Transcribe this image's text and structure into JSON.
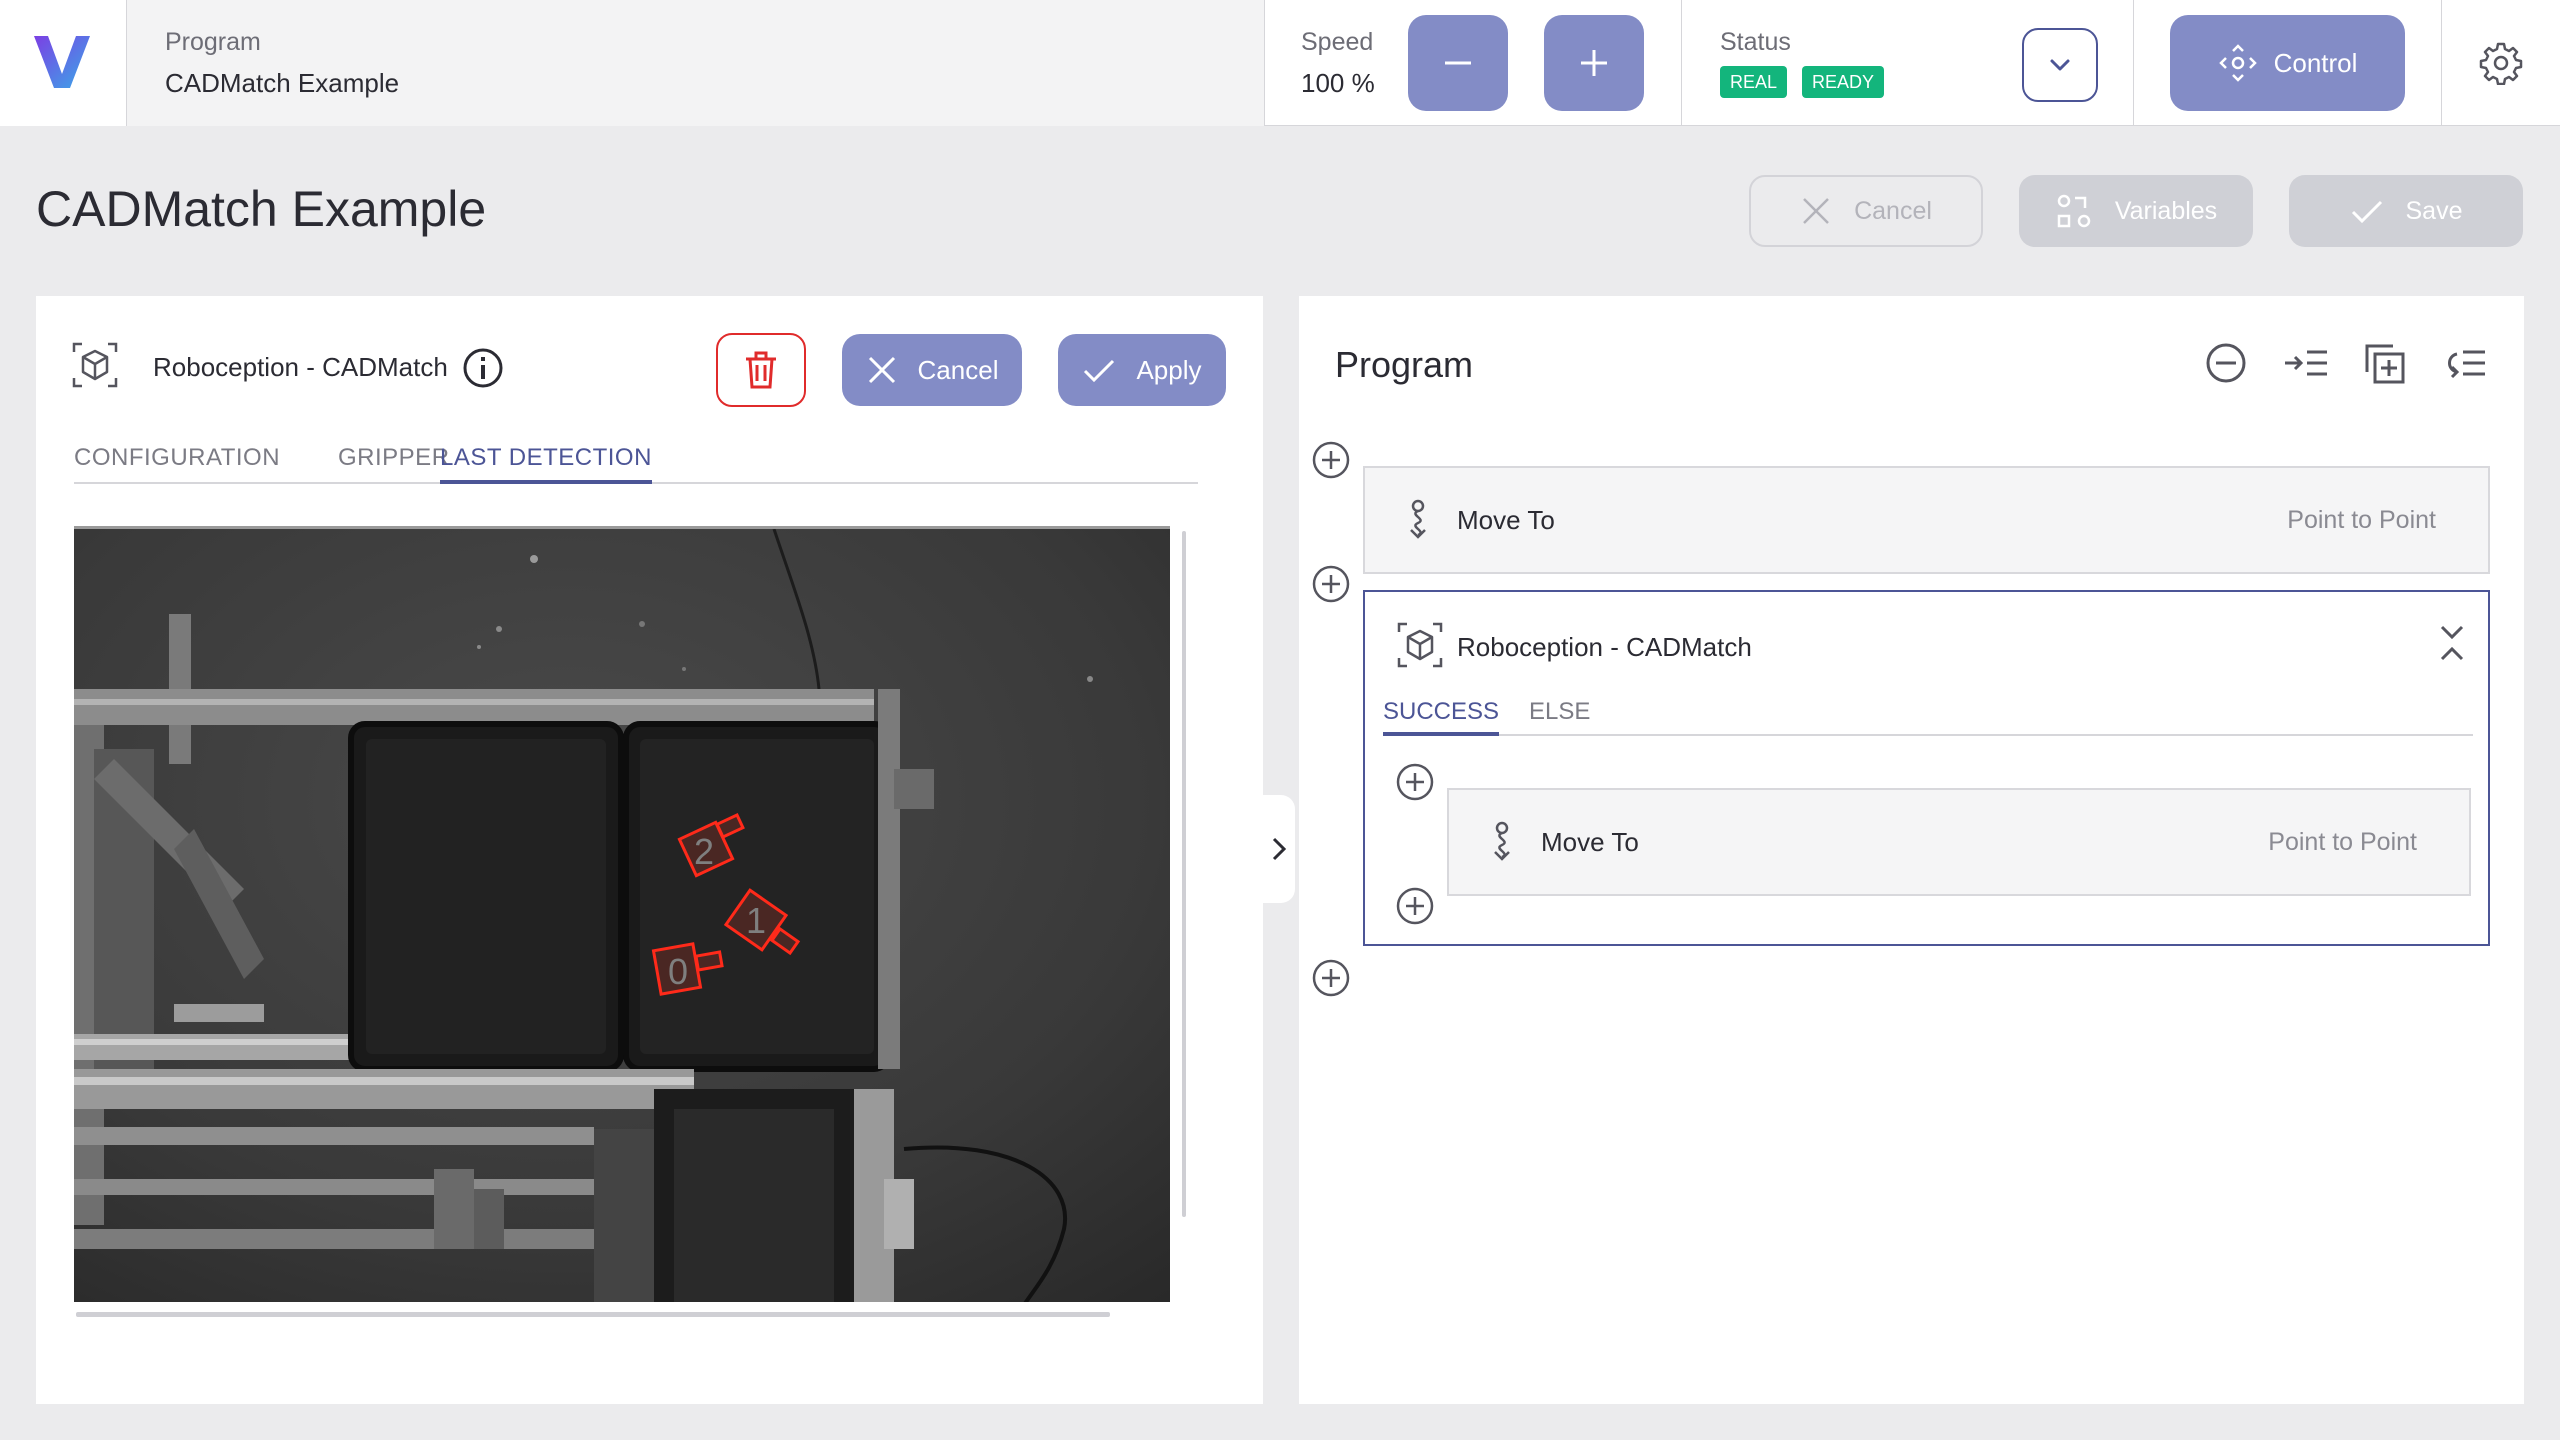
{
  "topbar": {
    "logo": "V",
    "program_label": "Program",
    "program_name": "CADMatch Example",
    "speed_label": "Speed",
    "speed_value": "100 %",
    "status_label": "Status",
    "badge_real": "REAL",
    "badge_ready": "READY",
    "control_label": "Control"
  },
  "page": {
    "title": "CADMatch Example",
    "cancel": "Cancel",
    "variables": "Variables",
    "save": "Save"
  },
  "left_panel": {
    "title": "Roboception - CADMatch",
    "cancel": "Cancel",
    "apply": "Apply",
    "tabs": [
      "CONFIGURATION",
      "GRIPPER",
      "LAST DETECTION"
    ],
    "active_tab": "LAST DETECTION",
    "detections": [
      "2",
      "1",
      "0"
    ]
  },
  "right_panel": {
    "title": "Program",
    "steps": [
      {
        "label": "Move To",
        "type": "Point to Point"
      },
      {
        "label": "Roboception - CADMatch"
      }
    ],
    "branch_tabs": [
      "SUCCESS",
      "ELSE"
    ],
    "active_branch": "SUCCESS",
    "nested_step": {
      "label": "Move To",
      "type": "Point to Point"
    }
  },
  "colors": {
    "accent": "#838cc6",
    "accent_dark": "#4c5596",
    "status_green": "#13b57c",
    "danger": "#e02b2b",
    "detection_red": "#ff2a1a"
  },
  "icons": [
    "logo-icon",
    "minus-icon",
    "plus-icon",
    "chevron-down-icon",
    "move-control-icon",
    "gear-icon",
    "close-icon",
    "variables-icon",
    "check-icon",
    "cadmatch-cube-icon",
    "info-icon",
    "trash-icon",
    "chevron-right-icon",
    "collapse-all-icon",
    "indent-icon",
    "add-copy-icon",
    "outdent-icon",
    "add-step-icon",
    "move-to-icon",
    "collapse-icon"
  ]
}
